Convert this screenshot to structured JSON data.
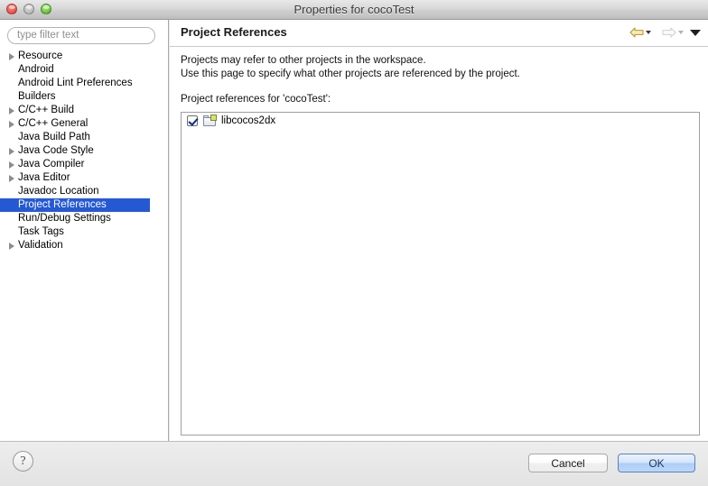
{
  "window": {
    "title": "Properties for cocoTest",
    "controls": [
      {
        "name": "close",
        "label": "Close"
      },
      {
        "name": "minimize",
        "label": "Minimize"
      },
      {
        "name": "zoom",
        "label": "Zoom"
      }
    ]
  },
  "sidebar": {
    "filter": {
      "value": "",
      "placeholder": "type filter text"
    },
    "items": [
      {
        "label": "Resource",
        "expandable": true,
        "selected": false
      },
      {
        "label": "Android",
        "expandable": false,
        "selected": false
      },
      {
        "label": "Android Lint Preferences",
        "expandable": false,
        "selected": false
      },
      {
        "label": "Builders",
        "expandable": false,
        "selected": false
      },
      {
        "label": "C/C++ Build",
        "expandable": true,
        "selected": false
      },
      {
        "label": "C/C++ General",
        "expandable": true,
        "selected": false
      },
      {
        "label": "Java Build Path",
        "expandable": false,
        "selected": false
      },
      {
        "label": "Java Code Style",
        "expandable": true,
        "selected": false
      },
      {
        "label": "Java Compiler",
        "expandable": true,
        "selected": false
      },
      {
        "label": "Java Editor",
        "expandable": true,
        "selected": false
      },
      {
        "label": "Javadoc Location",
        "expandable": false,
        "selected": false
      },
      {
        "label": "Project References",
        "expandable": false,
        "selected": true
      },
      {
        "label": "Run/Debug Settings",
        "expandable": false,
        "selected": false
      },
      {
        "label": "Task Tags",
        "expandable": false,
        "selected": false
      },
      {
        "label": "Validation",
        "expandable": true,
        "selected": false
      }
    ]
  },
  "content": {
    "title": "Project References",
    "nav": {
      "back_icon": "back-arrow-icon",
      "back_menu_icon": "chevron-down-icon",
      "forward_icon": "forward-arrow-icon",
      "forward_menu_icon": "chevron-down-icon",
      "menu_icon": "chevron-down-icon"
    },
    "description_line1": "Projects may refer to other projects in the workspace.",
    "description_line2": "Use this page to specify what other projects are referenced by the project.",
    "references_label": "Project references for 'cocoTest':",
    "references": [
      {
        "label": "libcocos2dx",
        "checked": true,
        "icon": "project-folder-icon"
      }
    ]
  },
  "footer": {
    "help_label": "?",
    "cancel_label": "Cancel",
    "ok_label": "OK"
  },
  "colors": {
    "selection_blue": "#2559d4",
    "default_button_blue": "#aecdf5",
    "back_arrow_yellow": "#f5e9a8"
  }
}
